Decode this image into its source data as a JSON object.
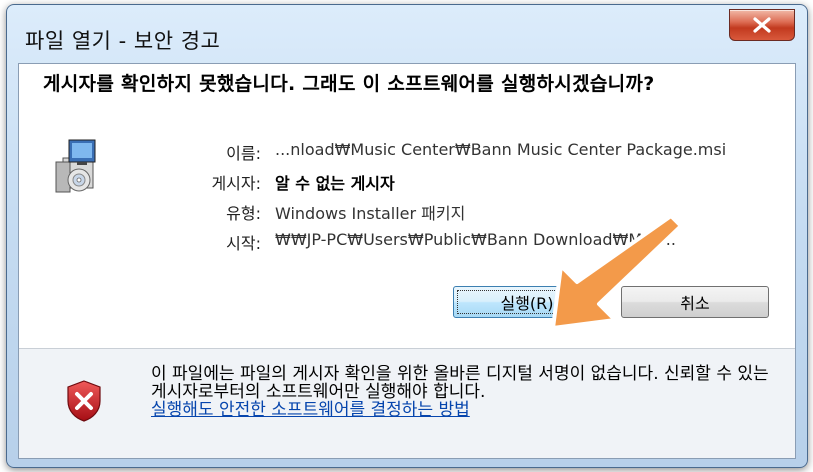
{
  "window": {
    "title": "파일 열기 - 보안 경고"
  },
  "headline": "게시자를 확인하지 못했습니다. 그래도 이 소프트웨어를 실행하시겠습니까?",
  "details": {
    "name_label": "이름:",
    "name_value": "...nload₩Music Center₩Bann Music Center Package.msi",
    "publisher_label": "게시자:",
    "publisher_value": "알 수 없는 게시자",
    "type_label": "유형:",
    "type_value": "Windows Installer 패키지",
    "from_label": "시작:",
    "from_value": "₩₩JP-PC₩Users₩Public₩Bann                    Download₩Mus..."
  },
  "buttons": {
    "run": "실행(R)",
    "cancel": "취소"
  },
  "footer": {
    "warning_text": "이 파일에는 파일의 게시자 확인을 위한 올바른 디지털 서명이 없습니다. 신뢰할 수 있는 게시자로부터의 소프트웨어만 실행해야 합니다.",
    "link_text": "실행해도 안전한 소프트웨어를 결정하는 방법"
  },
  "icons": {
    "close": "close-icon",
    "package": "installer-package-icon",
    "shield": "shield-x-icon",
    "arrow": "arrow-annotation-icon"
  },
  "colors": {
    "arrow": "#f39a4a",
    "close_button": "#c84a30",
    "link": "#0645ad",
    "shield": "#c8101e"
  }
}
